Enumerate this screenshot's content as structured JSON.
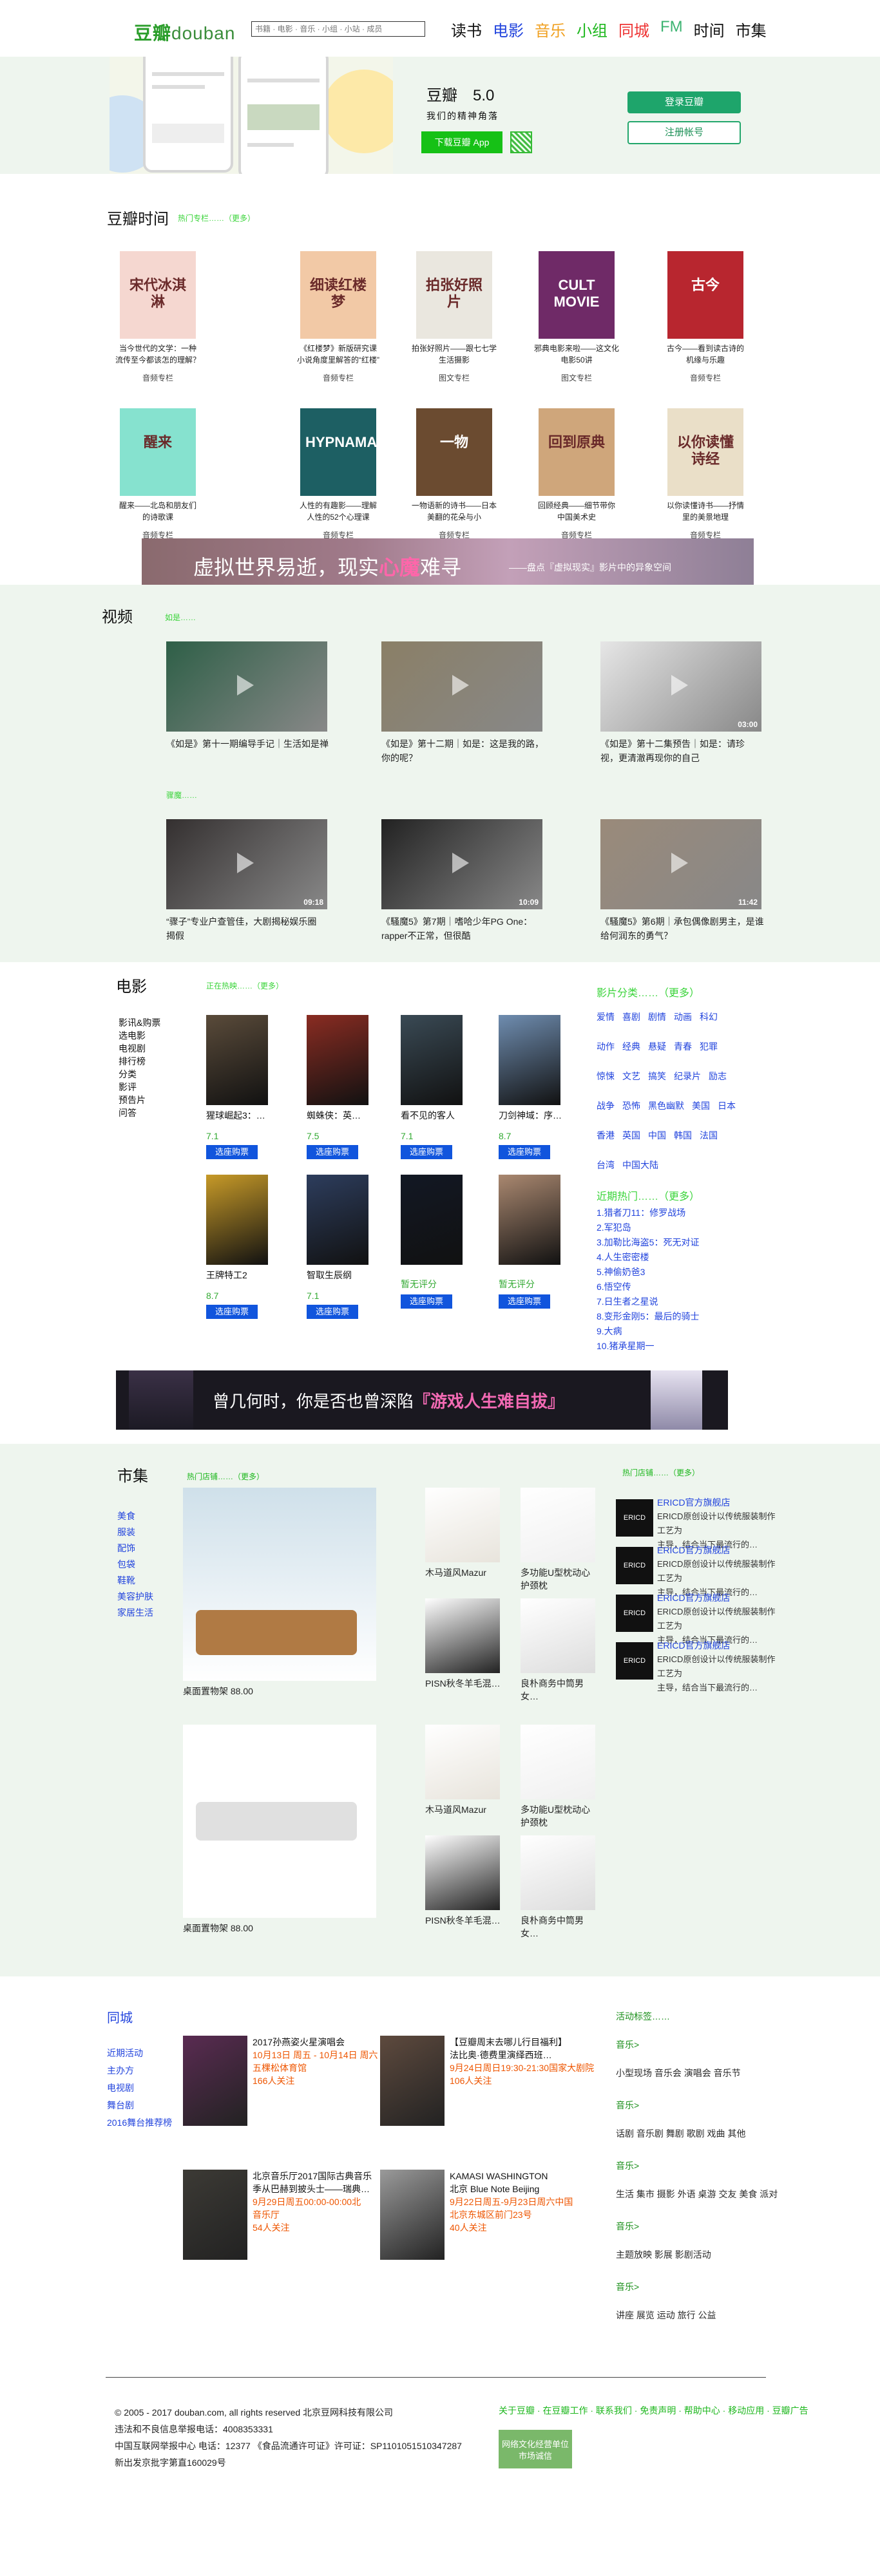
{
  "header": {
    "logo_cn": "豆瓣",
    "logo_en": "douban",
    "search_placeholder": "书籍 · 电影 · 音乐 · 小组 · 小站 · 成员",
    "nav": [
      {
        "label": "读书",
        "color": "#111111"
      },
      {
        "label": "电影",
        "color": "#2244dd"
      },
      {
        "label": "音乐",
        "color": "#f0a020"
      },
      {
        "label": "小组",
        "color": "#1db71d"
      },
      {
        "label": "同城",
        "color": "#ee3333"
      },
      {
        "label": "FM",
        "color": "#3cb371"
      },
      {
        "label": "时间",
        "color": "#111111"
      },
      {
        "label": "市集",
        "color": "#111111"
      }
    ]
  },
  "hero": {
    "brand": "豆瓣",
    "version": "5.0",
    "slogan": "我们的精神角落",
    "download": "下载豆瓣 App",
    "login": "登录豆瓣",
    "register": "注册帐号"
  },
  "time": {
    "title": "豆瓣时间",
    "sub": "热门专栏……（更多）",
    "items": [
      {
        "cap": "当今世代的文学：一种\n流传至今都该怎的理解？",
        "tag": "音频专栏",
        "bg": "#f5d7d0",
        "text": "宋代冰淇淋"
      },
      {
        "cap": "《红楼梦》新版研究课\n小说角度里解答的“红楼”",
        "tag": "音频专栏",
        "bg": "#f2c9a6",
        "text": "细读红楼梦"
      },
      {
        "cap": "拍张好照片——跟七七学\n生活摄影",
        "tag": "图文专栏",
        "bg": "#eae7df",
        "text": "拍张好照片"
      },
      {
        "cap": "邪典电影来啦——这文化\n电影50讲",
        "tag": "图文专栏",
        "bg": "#6f2a67",
        "text": "CULT MOVIE"
      },
      {
        "cap": "古今——看到读古诗的\n机缘与乐趣",
        "tag": "音频专栏",
        "bg": "#b8262f",
        "text": "古今"
      },
      {
        "cap": "醒来——北岛和朋友们\n的诗歌课",
        "tag": "音频专栏",
        "bg": "#86e2cf",
        "text": "醒来"
      },
      {
        "cap": "人性的有趣影——理解\n人性的52个心理课",
        "tag": "音频专栏",
        "bg": "#1d5f63",
        "text": "HYPNAMARA"
      },
      {
        "cap": "一物语新的诗书——日本\n美翻的花朵与小",
        "tag": "音频专栏",
        "bg": "#6b4b30",
        "text": "一物"
      },
      {
        "cap": "回顾经典——细节带你\n中国美术史",
        "tag": "音频专栏",
        "bg": "#cfa67b",
        "text": "回到原典"
      },
      {
        "cap": "以你读懂诗书——抒情\n里的美景地理",
        "tag": "音频专栏",
        "bg": "#eadfc8",
        "text": "以你读懂诗经"
      }
    ],
    "banner": {
      "main": "虚拟世界易逝，现实",
      "pink": "心魔",
      "tail": "难寻",
      "sub": "——盘点『虚拟现实』影片中的异象空间"
    }
  },
  "video": {
    "title": "视频",
    "sub1": "如是……",
    "sub2": "骤魔……",
    "items": [
      {
        "t": "《如是》第十一期编导手记｜生活如是禅",
        "dur": "",
        "bg": "#2e5f47"
      },
      {
        "t": "《如是》第十二期｜如是：这是我的路，\n你的呢？",
        "dur": "",
        "bg": "#8a7f66"
      },
      {
        "t": "《如是》第十二集预告｜如是：请珍\n视，更清澈再现你的自己",
        "dur": "03:00",
        "bg": "#e6e6e6"
      },
      {
        "t": "“骤子”专业户查管佳，大剧揭秘娱乐圈\n揭假",
        "dur": "09:18",
        "bg": "#343030"
      },
      {
        "t": "《騷魔5》第7期｜嗜哈少年PG One：\nrapper不正常，但很酷",
        "dur": "10:09",
        "bg": "#222"
      },
      {
        "t": "《騷魔5》第6期｜承包偶像剧男主，是谁\n给何润东的勇气？",
        "dur": "11:42",
        "bg": "#9a8a7a"
      }
    ]
  },
  "movie": {
    "title": "电影",
    "sub": "正在热映……（更多）",
    "menu": [
      "影讯&购票",
      "选电影",
      "电视剧",
      "排行榜",
      "分类",
      "影评",
      "预告片",
      "问答"
    ],
    "items": [
      {
        "n": "猩球崛起3：…",
        "r": "7.1",
        "b": "选座购票",
        "bg": "#5a4b3a"
      },
      {
        "n": "蜘蛛侠：英…",
        "r": "7.5",
        "b": "选座购票",
        "bg": "#8a2c22"
      },
      {
        "n": "看不见的客人",
        "r": "7.1",
        "b": "选座购票",
        "bg": "#3a4a55"
      },
      {
        "n": "刀剑神域：序…",
        "r": "8.7",
        "b": "选座购票",
        "bg": "#6f8db0"
      },
      {
        "n": "王牌特工2",
        "r": "8.7",
        "b": "选座购票",
        "bg": "#c79a28"
      },
      {
        "n": "智取生辰纲",
        "r": "7.1",
        "b": "选座购票",
        "bg": "#2d3d5d"
      },
      {
        "n": "",
        "r": "暂无评分",
        "b": "选座购票",
        "bg": "#121824"
      },
      {
        "n": "",
        "r": "暂无评分",
        "b": "选座购票",
        "bg": "#aa8870"
      }
    ],
    "cat_title": "影片分类……（更多）",
    "cats": [
      [
        "爱情",
        "喜剧",
        "剧情",
        "动画",
        "科幻"
      ],
      [
        "动作",
        "经典",
        "悬疑",
        "青春",
        "犯罪"
      ],
      [
        "惊悚",
        "文艺",
        "搞笑",
        "纪录片",
        "励志"
      ],
      [
        "战争",
        "恐怖",
        "黑色幽默",
        "美国",
        "日本"
      ],
      [
        "香港",
        "英国",
        "中国",
        "韩国",
        "法国"
      ],
      [
        "台湾",
        "中国大陆"
      ]
    ],
    "hot_title": "近期热门……（更多）",
    "hot": [
      "1.猎者刀11：修罗战场",
      "2.军犯岛",
      "3.加勒比海盗5：死无对证",
      "4.人生密密楼",
      "5.神偷奶爸3",
      "6.悟空传",
      "7.日生者之星说",
      "8.变形金刚5：最后的骑士",
      "9.大病",
      "10.猪承星期一"
    ],
    "banner": {
      "pre": "曾几何时，你是否也曾深陷",
      "pink": "『游戏人生难自拔』"
    }
  },
  "market": {
    "title": "市集",
    "sub": "热门店铺……（更多）",
    "menu": [
      "美食",
      "服装",
      "配饰",
      "包袋",
      "鞋靴",
      "美容护肤",
      "家居生活"
    ],
    "big": [
      {
        "nm": "桌面置物架 88.00"
      },
      {
        "nm": "桌面置物架 88.00"
      }
    ],
    "small": [
      {
        "nm": "木马道风Mazur"
      },
      {
        "nm": "多功能U型枕动心护颈枕"
      },
      {
        "nm": "PISN秋冬羊毛混…"
      },
      {
        "nm": "良朴商务中筒男女…"
      },
      {
        "nm": "木马道风Mazur"
      },
      {
        "nm": "多功能U型枕动心护颈枕"
      },
      {
        "nm": "PISN秋冬羊毛混…"
      },
      {
        "nm": "良朴商务中筒男女…"
      }
    ],
    "shops_title": "热门店铺……（更多）",
    "shops": [
      {
        "logo": "ERICD",
        "t1": "ERICD官方旗舰店",
        "t2": "ERICD原创设计以传统服装制作工艺为\n主导，结合当下最流行的…"
      },
      {
        "logo": "ERICD",
        "t1": "ERICD官方旗舰店",
        "t2": "ERICD原创设计以传统服装制作工艺为\n主导，结合当下最流行的…"
      },
      {
        "logo": "ERICD",
        "t1": "ERICD官方旗舰店",
        "t2": "ERICD原创设计以传统服装制作工艺为\n主导，结合当下最流行的…"
      },
      {
        "logo": "ERICD",
        "t1": "ERICD官方旗舰店",
        "t2": "ERICD原创设计以传统服装制作工艺为\n主导，结合当下最流行的…"
      }
    ]
  },
  "city": {
    "title": "同城",
    "menu": [
      "近期活动",
      "主办方",
      "电视剧",
      "舞台剧",
      "2016舞台推荐榜"
    ],
    "events": [
      {
        "ti": "2017孙燕姿火星演唱会",
        "d": "10月13日 周五 - 10月14日 周六",
        "p": "五棵松体育馆",
        "c": "166人关注",
        "bg": "#5a2b52"
      },
      {
        "ti": "【豆瓣周末去哪儿行目福利】",
        "ti2": "法比奥·德费里演绎西班…",
        "d": "9月24日周日19:30-21:30国家大剧院",
        "c": "106人关注",
        "bg": "#5e4a3e"
      },
      {
        "ti": "北京音乐厅2017国际古典音乐",
        "ti2": "季从巴赫到披头士——瑞典…",
        "d": "9月29日周五00:00-00:00北",
        "p": "音乐厅",
        "c": "54人关注",
        "bg": "#3c3a35"
      },
      {
        "ti": "KAMASI WASHINGTON",
        "ti2": "北京 Blue Note Beijing",
        "d": "9月22日周五-9月23日周六中国",
        "p": "北京东城区前门23号",
        "c": "40人关注",
        "bg": "#9a9a9a"
      }
    ],
    "side": [
      {
        "h": "活动标签……",
        "l": ""
      },
      {
        "h": "音乐>",
        "l": "小型现场 音乐会 演唱会 音乐节"
      },
      {
        "h": "音乐>",
        "l": "话剧 音乐剧 舞剧 歌剧 戏曲 其他"
      },
      {
        "h": "音乐>",
        "l": "生活 集市 摄影 外语 桌游 交友 美食 派对"
      },
      {
        "h": "音乐>",
        "l": "主题放映 影展 影剧活动"
      },
      {
        "h": "音乐>",
        "l": "讲座 展览 运动 旅行 公益"
      }
    ]
  },
  "footer": {
    "lines": [
      "© 2005 - 2017 douban.com, all rights reserved 北京豆网科技有限公司",
      "违法和不良信息举报电话：4008353331",
      "中国互联网举报中心 电话：12377 《食品流通许可证》许可证：SP1101051510347287",
      "新出发京批字第直160029号"
    ],
    "links": "关于豆瓣 · 在豆瓣工作 · 联系我们 · 免责声明 · 帮助中心 · 移动应用 · 豆瓣广告",
    "badge": "网络文化经营单位\n市场诚信"
  }
}
